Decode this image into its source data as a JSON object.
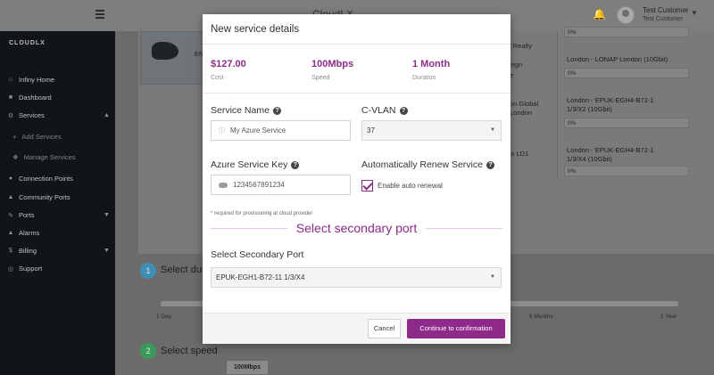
{
  "topbar": {
    "brand": "CloudLX",
    "user_name": "Test Customer",
    "user_sub": "Test Customer"
  },
  "sidebar": {
    "brand": "CLOUDLX",
    "items": [
      {
        "label": "Infiny Home",
        "icon": "home-icon"
      },
      {
        "label": "Dashboard",
        "icon": "dashboard-icon"
      },
      {
        "label": "Services",
        "icon": "services-icon"
      },
      {
        "label": "Add Services",
        "icon": "plus-icon"
      },
      {
        "label": "Manage Services",
        "icon": "wrench-icon"
      },
      {
        "label": "Connection Points",
        "icon": "connection-icon"
      },
      {
        "label": "Community Ports",
        "icon": "community-icon"
      },
      {
        "label": "Ports",
        "icon": "ports-icon"
      },
      {
        "label": "Alarms",
        "icon": "bell-icon"
      },
      {
        "label": "Billing",
        "icon": "billing-icon"
      },
      {
        "label": "Support",
        "icon": "support-icon"
      }
    ]
  },
  "background": {
    "row1_a": "EN",
    "row1_b": "l Realty",
    "row1_c": "eign",
    "row1_d": "e",
    "row2_a": "on Global",
    "row2_b": "London",
    "row3_a": "ix LD1",
    "right_pct_1": "0%",
    "right_name_2": "London - LONAP London (10Gbit)",
    "right_pct_2": "0%",
    "right_name_3a": "London - EPUK-EGH4-B72-1",
    "right_name_3b": "1/3/X2 (10Gbit)",
    "right_pct_3": "0%",
    "right_name_4a": "London - EPUK-EGH4-B72-1",
    "right_name_4b": "1/3/X4 (10Gbit)",
    "right_pct_4": "0%",
    "step1_num": "1",
    "step1_label": "Select dur",
    "step2_num": "2",
    "step2_label": "Select speed",
    "tick_1day": "1 Day",
    "tick_6months": "6 Months",
    "tick_1year": "1 Year",
    "speed_option": "100Mbps"
  },
  "modal": {
    "title": "New service details",
    "stats": [
      {
        "value": "$127.00",
        "label": "Cost"
      },
      {
        "value": "100Mbps",
        "label": "Speed"
      },
      {
        "value": "1 Month",
        "label": "Duration"
      }
    ],
    "service_name_label": "Service Name",
    "service_name_value": "My Azure Service",
    "cvlan_label": "C-VLAN",
    "cvlan_value": "37",
    "azure_key_label": "Azure Service Key",
    "azure_key_value": "1234567891234",
    "azure_key_hint": "* required for provisioning at cloud provider",
    "auto_renew_label": "Automatically Renew Service",
    "auto_renew_checkbox": "Enable auto renewal",
    "secondary_section": "Select secondary port",
    "secondary_port_label": "Select Secondary Port",
    "secondary_port_value": "EPUK-EGH1-B72-11 1/3/X4",
    "cancel": "Cancel",
    "confirm": "Continue to confirmation"
  },
  "colors": {
    "accent": "#8e2a8a",
    "sidebar": "#111418",
    "step1": "#3d8fb3",
    "step2": "#3a9a5a"
  }
}
